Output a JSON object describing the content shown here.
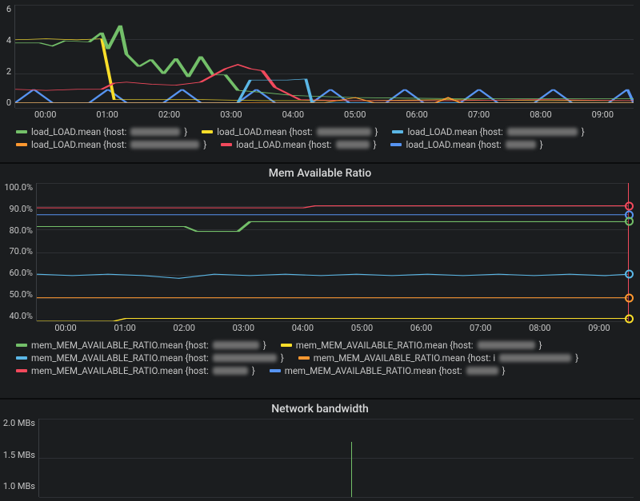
{
  "panels": {
    "load": {
      "y_labels": [
        "6",
        "4",
        "2",
        "0"
      ],
      "x_labels": [
        "00:00",
        "01:00",
        "02:00",
        "03:00",
        "04:00",
        "05:00",
        "06:00",
        "07:00",
        "08:00",
        "09:00"
      ],
      "legend": [
        {
          "color": "#73bf69",
          "label": "load_LOAD.mean {host: ",
          "hostw": 62
        },
        {
          "color": "#fade2a",
          "label": "load_LOAD.mean {host: ",
          "hostw": 68
        },
        {
          "color": "#5bb7e6",
          "label": "load_LOAD.mean {host: ",
          "hostw": 88
        },
        {
          "color": "#ff9830",
          "label": "load_LOAD.mean {host: ",
          "hostw": 86
        },
        {
          "color": "#f2495c",
          "label": "load_LOAD.mean {host: ",
          "hostw": 42
        },
        {
          "color": "#5794f2",
          "label": "load_LOAD.mean {host: ",
          "hostw": 38
        }
      ]
    },
    "mem": {
      "title": "Mem Available Ratio",
      "y_labels": [
        "100.0%",
        "90.0%",
        "80.0%",
        "70.0%",
        "60.0%",
        "50.0%",
        "40.0%"
      ],
      "x_labels": [
        "00:00",
        "01:00",
        "02:00",
        "03:00",
        "04:00",
        "05:00",
        "06:00",
        "07:00",
        "08:00",
        "09:00"
      ],
      "legend": [
        {
          "color": "#73bf69",
          "label": "mem_MEM_AVAILABLE_RATIO.mean {host: ",
          "hostw": 58
        },
        {
          "color": "#fade2a",
          "label": "mem_MEM_AVAILABLE_RATIO.mean {host: ",
          "hostw": 72
        },
        {
          "color": "#5bb7e6",
          "label": "mem_MEM_AVAILABLE_RATIO.mean {host: ",
          "hostw": 80
        },
        {
          "color": "#ff9830",
          "label": "mem_MEM_AVAILABLE_RATIO.mean {host: i",
          "hostw": 90
        },
        {
          "color": "#f2495c",
          "label": "mem_MEM_AVAILABLE_RATIO.mean {host: ",
          "hostw": 44
        },
        {
          "color": "#5794f2",
          "label": "mem_MEM_AVAILABLE_RATIO.mean {host: ",
          "hostw": 40
        }
      ]
    },
    "net": {
      "title": "Network bandwidth",
      "y_labels": [
        "2.0 MBs",
        "1.5 MBs",
        "1.0 MBs"
      ]
    }
  },
  "colors": {
    "green": "#73bf69",
    "yellow": "#fade2a",
    "cyan": "#5bb7e6",
    "orange": "#ff9830",
    "red": "#f2495c",
    "blue": "#5794f2"
  },
  "chart_data": [
    {
      "type": "line",
      "title": "",
      "xlabel": "",
      "ylabel": "",
      "ylim": [
        0,
        6
      ],
      "x": [
        "23:30",
        "00:00",
        "00:30",
        "01:00",
        "01:30",
        "02:00",
        "02:30",
        "03:00",
        "03:30",
        "04:00",
        "04:30",
        "05:00",
        "05:30",
        "06:00",
        "06:30",
        "07:00",
        "07:30",
        "08:00",
        "08:30",
        "09:00",
        "09:30"
      ],
      "series": [
        {
          "name": "load_LOAD.mean (green)",
          "color": "#73bf69",
          "values": [
            3.8,
            3.8,
            3.6,
            4.4,
            3.2,
            2.1,
            1.9,
            3.0,
            2.0,
            1.2,
            0.9,
            0.7,
            0.6,
            0.5,
            0.5,
            0.5,
            0.5,
            0.5,
            0.5,
            0.5,
            0.5
          ]
        },
        {
          "name": "load_LOAD.mean (yellow)",
          "color": "#fade2a",
          "values": [
            4.0,
            4.0,
            3.9,
            4.0,
            0.6,
            0.5,
            0.5,
            0.5,
            0.4,
            0.4,
            0.4,
            0.4,
            0.4,
            0.4,
            0.5,
            0.4,
            0.4,
            0.4,
            0.4,
            0.4,
            0.4
          ]
        },
        {
          "name": "load_LOAD.mean (cyan)",
          "color": "#5bb7e6",
          "values": [
            0.3,
            0.3,
            0.3,
            0.3,
            0.3,
            0.3,
            0.3,
            0.3,
            0.3,
            1.6,
            1.6,
            1.6,
            0.3,
            0.3,
            0.3,
            0.3,
            0.3,
            0.3,
            0.3,
            0.3,
            0.3
          ]
        },
        {
          "name": "load_LOAD.mean (orange)",
          "color": "#ff9830",
          "values": [
            0.3,
            0.3,
            0.3,
            0.3,
            0.3,
            0.3,
            0.3,
            0.3,
            0.3,
            0.3,
            0.3,
            0.4,
            0.3,
            0.7,
            0.3,
            0.3,
            0.3,
            0.6,
            0.3,
            0.3,
            0.3
          ]
        },
        {
          "name": "load_LOAD.mean (red)",
          "color": "#f2495c",
          "values": [
            1.1,
            1.0,
            1.0,
            1.1,
            1.5,
            1.5,
            1.4,
            1.3,
            2.2,
            2.3,
            1.2,
            0.5,
            0.4,
            0.4,
            0.4,
            0.4,
            0.4,
            0.4,
            0.4,
            0.5,
            0.4
          ]
        },
        {
          "name": "load_LOAD.mean (blue)",
          "color": "#5794f2",
          "values": [
            0.3,
            1.0,
            0.3,
            1.0,
            0.3,
            1.0,
            0.3,
            1.0,
            0.3,
            1.0,
            0.3,
            1.0,
            0.3,
            1.0,
            0.3,
            1.0,
            0.3,
            1.0,
            0.3,
            1.0,
            0.3
          ]
        }
      ]
    },
    {
      "type": "line",
      "title": "Mem Available Ratio",
      "xlabel": "",
      "ylabel": "",
      "ylim": [
        40,
        100
      ],
      "x": [
        "23:30",
        "00:00",
        "01:00",
        "02:00",
        "03:00",
        "04:00",
        "05:00",
        "06:00",
        "07:00",
        "08:00",
        "09:00",
        "09:30"
      ],
      "series": [
        {
          "name": "mem_MEM_AVAILABLE_RATIO.mean (green)",
          "color": "#73bf69",
          "values": [
            81,
            81,
            81,
            81,
            79,
            83,
            83,
            83,
            83,
            83,
            83,
            83
          ]
        },
        {
          "name": "mem_MEM_AVAILABLE_RATIO.mean (yellow)",
          "color": "#fade2a",
          "values": [
            40,
            40,
            41,
            41,
            41,
            41,
            41,
            41,
            41,
            41,
            41,
            41
          ]
        },
        {
          "name": "mem_MEM_AVAILABLE_RATIO.mean (cyan)",
          "color": "#5bb7e6",
          "values": [
            60,
            60,
            60,
            59,
            60,
            60,
            60,
            60,
            60,
            60,
            60,
            60
          ]
        },
        {
          "name": "mem_MEM_AVAILABLE_RATIO.mean (orange)",
          "color": "#ff9830",
          "values": [
            50,
            50,
            50,
            50,
            50,
            50,
            50,
            50,
            50,
            50,
            50,
            50
          ]
        },
        {
          "name": "mem_MEM_AVAILABLE_RATIO.mean (red)",
          "color": "#f2495c",
          "values": [
            89,
            89,
            89,
            89,
            89,
            89,
            90,
            90,
            90,
            90,
            90,
            90
          ]
        },
        {
          "name": "mem_MEM_AVAILABLE_RATIO.mean (blue)",
          "color": "#5794f2",
          "values": [
            86,
            86,
            86,
            86,
            86,
            86,
            86,
            86,
            86,
            86,
            86,
            86
          ]
        }
      ]
    },
    {
      "type": "line",
      "title": "Network bandwidth",
      "xlabel": "",
      "ylabel": "",
      "ylim": [
        1.0,
        2.0
      ],
      "x": [
        "00:00",
        "01:00",
        "02:00",
        "03:00",
        "04:00",
        "05:00",
        "06:00",
        "07:00",
        "08:00",
        "09:00"
      ],
      "series": []
    }
  ]
}
